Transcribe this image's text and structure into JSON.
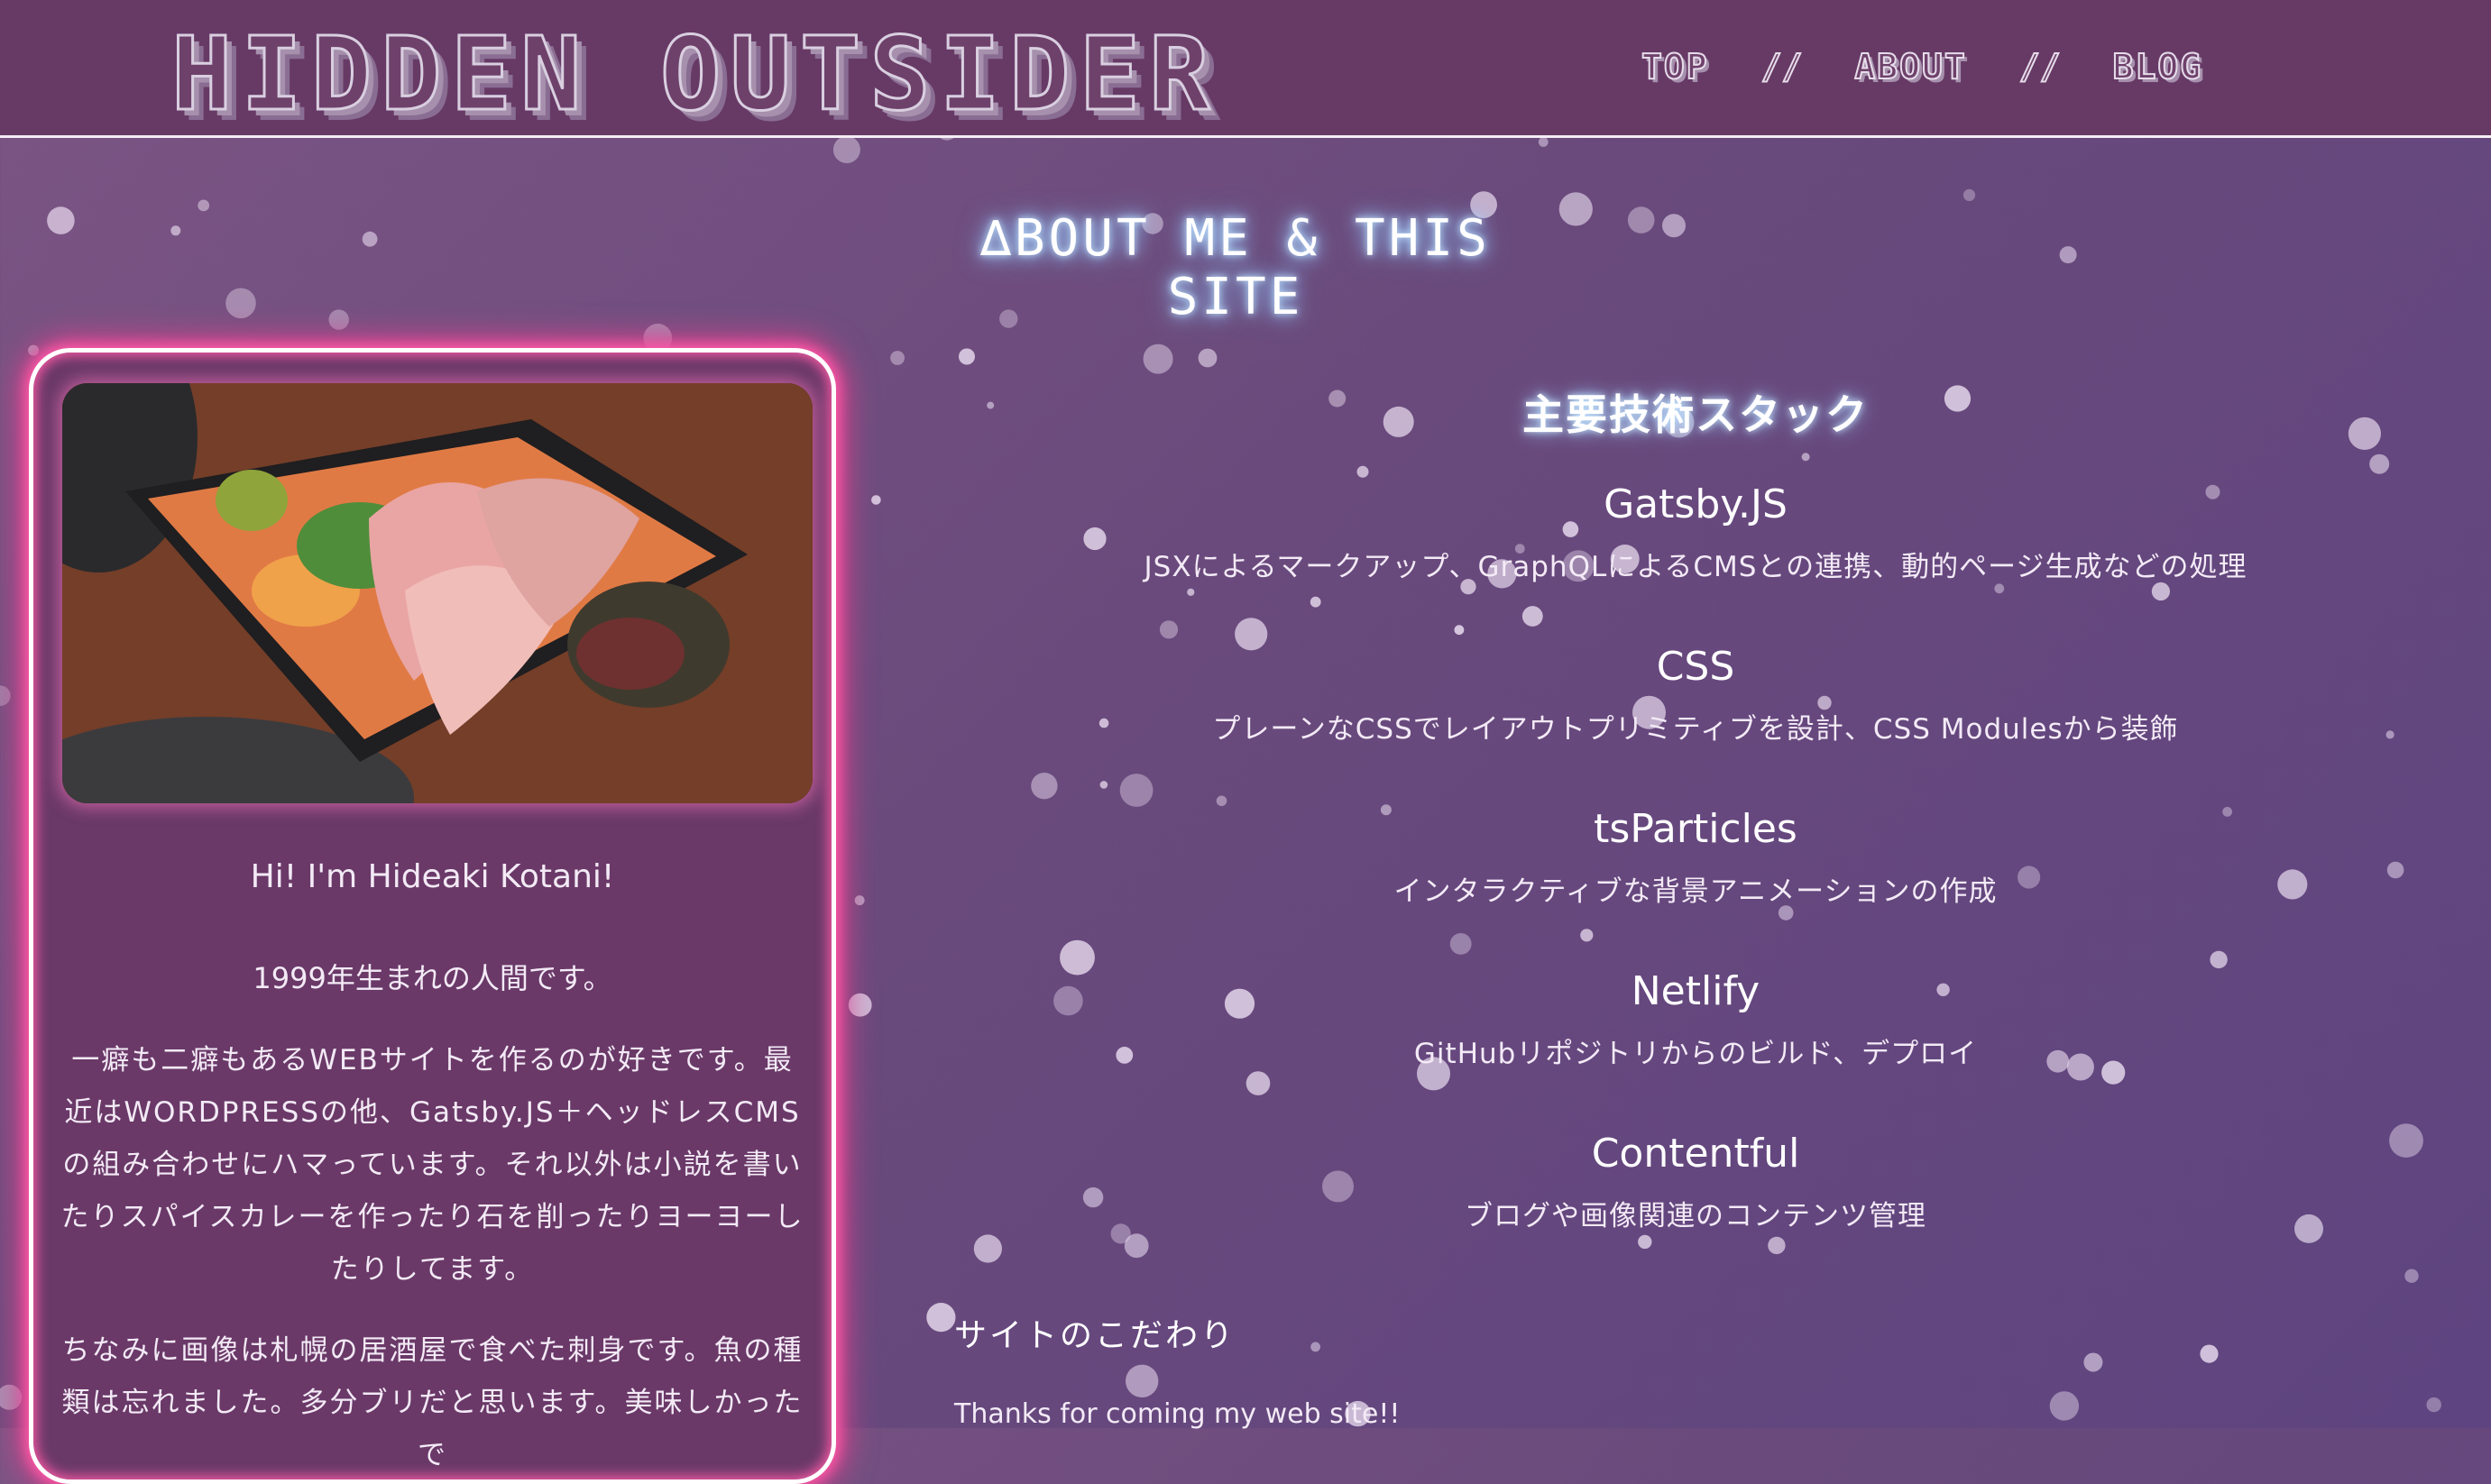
{
  "site": {
    "logo": "HIDDEN OUTSIDER",
    "nav": {
      "top": "TOP",
      "about": "ABOUT",
      "blog": "BLOG",
      "separator": "//"
    }
  },
  "page": {
    "title": "∆BOUT ME & THIS SITE"
  },
  "profile": {
    "photo_subject": "sashimi-plate",
    "greeting": "Hi! I'm Hideaki Kotani!",
    "birth": "1999年生まれの人間です。",
    "bio": "一癖も二癖もあるWEBサイトを作るのが好きです。最近はWORDPRESSの他、Gatsby.JS＋ヘッドレスCMSの組み合わせにハマっています。それ以外は小説を書いたりスパイスカレーを作ったり石を削ったりヨーヨーしたりしてます。",
    "photo_note": "ちなみに画像は札幌の居酒屋で食べた刺身です。魚の種類は忘れました。多分ブリだと思います。美味しかったで"
  },
  "stack": {
    "title": "主要技術スタック",
    "items": [
      {
        "name": "Gatsby.JS",
        "desc": "JSXによるマークアップ、GraphQLによるCMSとの連携、動的ページ生成などの処理"
      },
      {
        "name": "CSS",
        "desc": "プレーンなCSSでレイアウトプリミティブを設計、CSS Modulesから装飾"
      },
      {
        "name": "tsParticles",
        "desc": "インタラクティブな背景アニメーションの作成"
      },
      {
        "name": "Netlify",
        "desc": "GitHubリポジトリからのビルド、デプロイ"
      },
      {
        "name": "Contentful",
        "desc": "ブログや画像関連のコンテンツ管理"
      }
    ]
  },
  "kodawari": {
    "heading": "サイトのこだわり",
    "text": "Thanks for coming my web site!!"
  },
  "colors": {
    "header_bg": "#673a66",
    "page_bg_start": "#7b5584",
    "page_bg_end": "#5e4480",
    "card_glow": "#ff5aa8",
    "title_glow": "#a3d2ff",
    "particle": "#e9dcef"
  }
}
